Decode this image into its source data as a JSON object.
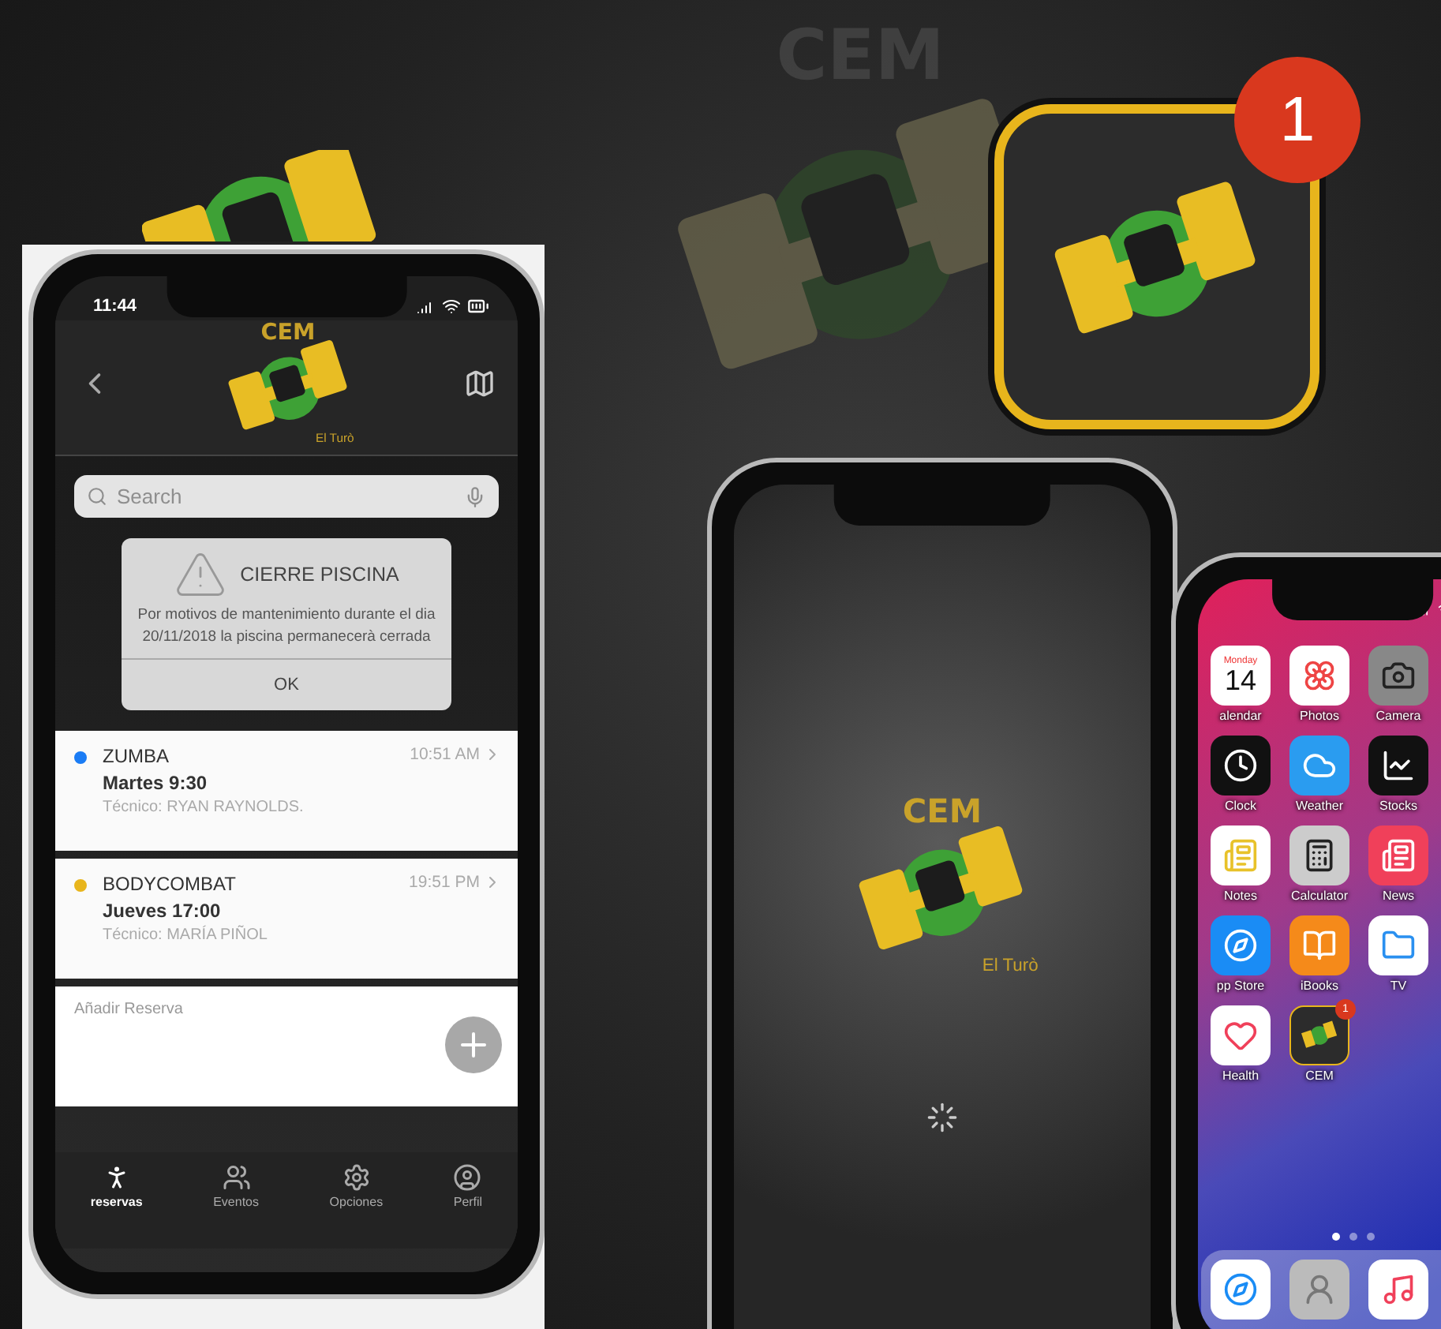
{
  "background_logo": {
    "text": "CEM"
  },
  "app_icon": {
    "badge": "1"
  },
  "app_phone": {
    "status_bar": {
      "time": "11:44"
    },
    "header": {
      "logo_top": "CEM",
      "logo_bottom": "El Turò"
    },
    "search": {
      "placeholder": "Search"
    },
    "alert": {
      "title": "CIERRE PISCINA",
      "message": "Por motivos de mantenimiento durante el dia 20/11/2018 la piscina permanecerà cerrada",
      "button": "OK"
    },
    "bookings": [
      {
        "title": "ZUMBA",
        "day": "Martes 9:30",
        "trainer": "Técnico: RYAN RAYNOLDS.",
        "time": "10:51 AM",
        "color": "#1a7cf5"
      },
      {
        "title": "BODYCOMBAT",
        "day": "Jueves 17:00",
        "trainer": "Técnico: MARÍA PIÑOL",
        "time": "19:51 PM",
        "color": "#e8b51c"
      }
    ],
    "add_booking": {
      "label": "Añadir Reserva"
    },
    "tabs": [
      {
        "label": "reservas",
        "kind": "walk",
        "selected": true
      },
      {
        "label": "Eventos",
        "kind": "people",
        "selected": false
      },
      {
        "label": "Opciones",
        "kind": "gear",
        "selected": false
      },
      {
        "label": "Perfil",
        "kind": "person",
        "selected": false
      }
    ]
  },
  "splash_phone": {
    "logo_top": "CEM",
    "logo_bottom": "El Turò"
  },
  "home_phone": {
    "apps": [
      {
        "kind": "calendar",
        "label": "alendar",
        "day": "Monday",
        "date": "14"
      },
      {
        "kind": "photos",
        "label": "Photos"
      },
      {
        "kind": "camera",
        "label": "Camera"
      },
      {
        "kind": "clock",
        "label": "Clock"
      },
      {
        "kind": "weather",
        "label": "Weather"
      },
      {
        "kind": "stocks",
        "label": "Stocks"
      },
      {
        "kind": "notes",
        "label": "Notes"
      },
      {
        "kind": "calculator",
        "label": "Calculator"
      },
      {
        "kind": "news",
        "label": "News"
      },
      {
        "kind": "appstore",
        "label": "pp Store"
      },
      {
        "kind": "books",
        "label": "iBooks"
      },
      {
        "kind": "files",
        "label": "TV"
      },
      {
        "kind": "health",
        "label": "Health"
      },
      {
        "kind": "cem",
        "label": "CEM",
        "badge": "1"
      }
    ],
    "page_dots": [
      {
        "selected": true
      },
      {
        "selected": false
      },
      {
        "selected": false
      }
    ],
    "dock": [
      {
        "kind": "compass"
      },
      {
        "kind": "contacts"
      },
      {
        "kind": "music"
      }
    ]
  }
}
